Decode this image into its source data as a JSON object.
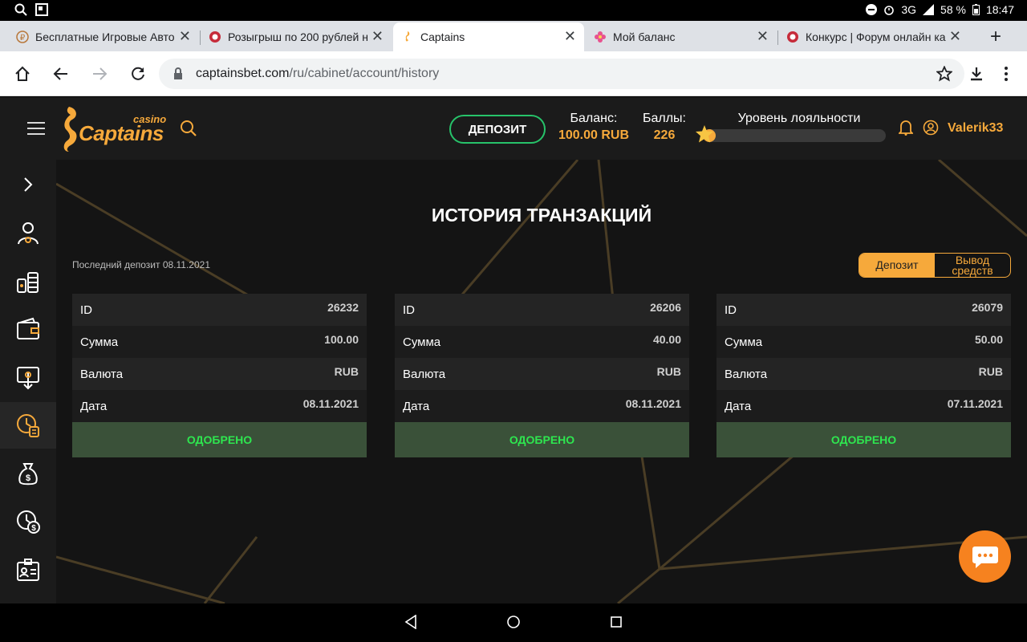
{
  "status_bar": {
    "network": "3G",
    "battery": "58 %",
    "time": "18:47"
  },
  "tabs": [
    {
      "title": "Бесплатные Игровые Авто",
      "favicon": "coin-icon",
      "active": false
    },
    {
      "title": "Розыгрыш по 200 рублей н",
      "favicon": "chip-icon",
      "active": false
    },
    {
      "title": "Captains",
      "favicon": "seahorse-icon",
      "active": true
    },
    {
      "title": "Мой баланс",
      "favicon": "flower-icon",
      "active": false
    },
    {
      "title": "Конкурс | Форум онлайн ка",
      "favicon": "chip-icon",
      "active": false
    }
  ],
  "address": {
    "host": "captainsbet.com",
    "path": "/ru/cabinet/account/history"
  },
  "header": {
    "logo_small": "casino",
    "logo_brand": "Captains",
    "deposit_label": "ДЕПОЗИТ",
    "balance_label": "Баланс:",
    "balance_value": "100.00 RUB",
    "points_label": "Баллы:",
    "points_value": "226",
    "loyalty_label": "Уровень лояльности",
    "loyalty_progress": 0.07,
    "username": "Valerik33"
  },
  "colors": {
    "accent": "#f6a93b",
    "deposit_border": "#27c36a",
    "approved_bg": "#3a5139",
    "approved_text": "#2ee64f",
    "chat": "#f6821f"
  },
  "sidebar": {
    "items": [
      {
        "icon": "chevron-right-icon"
      },
      {
        "icon": "profile-icon"
      },
      {
        "icon": "coins-icon"
      },
      {
        "icon": "wallet-icon"
      },
      {
        "icon": "withdraw-icon"
      },
      {
        "icon": "history-icon",
        "active": true
      },
      {
        "icon": "money-bag-icon"
      },
      {
        "icon": "clock-dollar-icon"
      },
      {
        "icon": "id-card-icon"
      }
    ]
  },
  "main": {
    "title": "ИСТОРИЯ ТРАНЗАКЦИЙ",
    "last_deposit": "Последний депозит 08.11.2021",
    "toggle": {
      "deposit": "Депозит",
      "withdraw": "Вывод средств"
    },
    "row_labels": {
      "id": "ID",
      "amount": "Сумма",
      "currency": "Валюта",
      "date": "Дата"
    },
    "transactions": [
      {
        "id": "26232",
        "amount": "100.00",
        "currency": "RUB",
        "date": "08.11.2021",
        "status": "ОДОБРЕНО"
      },
      {
        "id": "26206",
        "amount": "40.00",
        "currency": "RUB",
        "date": "08.11.2021",
        "status": "ОДОБРЕНО"
      },
      {
        "id": "26079",
        "amount": "50.00",
        "currency": "RUB",
        "date": "07.11.2021",
        "status": "ОДОБРЕНО"
      }
    ]
  }
}
